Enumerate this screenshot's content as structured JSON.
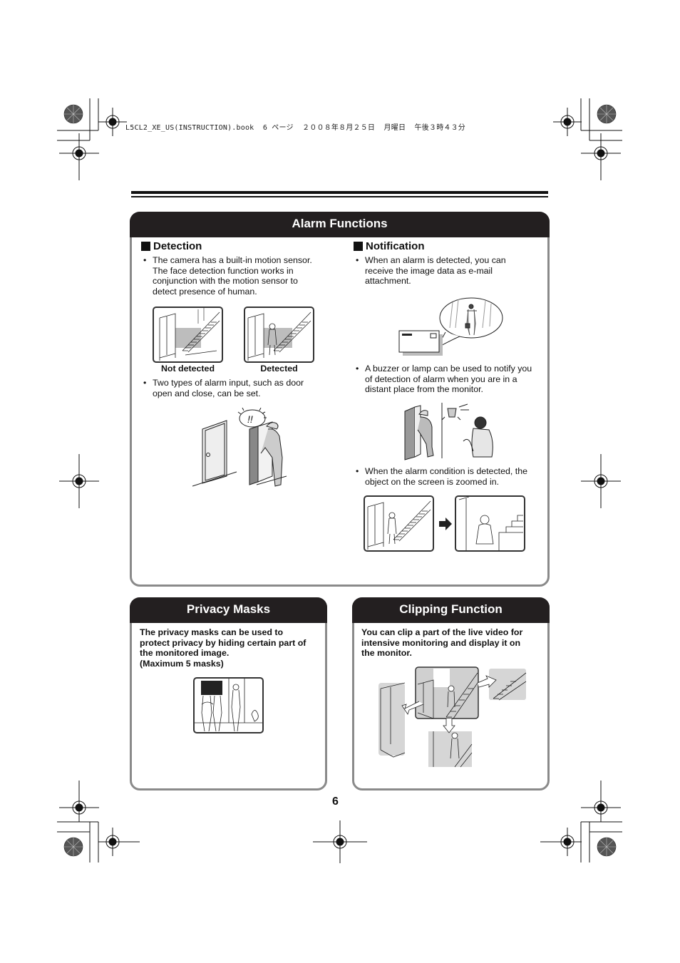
{
  "print_header": "L5CL2_XE_US(INSTRUCTION).book  6 ページ  ２００８年８月２５日  月曜日  午後３時４３分",
  "alarm": {
    "title": "Alarm Functions",
    "detection": {
      "heading": "Detection",
      "bullet1": "The camera has a built-in motion sensor. The face detection function works in conjunction with the motion sensor to detect presence of human.",
      "captions": [
        "Not detected",
        "Detected"
      ],
      "bullet2": "Two types of alarm input, such as door open and close, can be set."
    },
    "notification": {
      "heading": "Notification",
      "bullet1": "When an alarm is detected, you can receive the image data as e-mail attachment.",
      "bullet2": "A buzzer or lamp can be used to notify you of detection of alarm when you are in a distant place from the monitor.",
      "bullet3": "When the alarm condition is detected, the object on the screen is zoomed in."
    },
    "bullet_char": "•",
    "exclaim": "!!"
  },
  "privacy": {
    "title": "Privacy Masks",
    "text_lines": [
      "The privacy masks can be used to",
      "protect privacy by hiding certain part of",
      "the monitored image.",
      "(Maximum 5 masks)"
    ]
  },
  "clipping": {
    "title": "Clipping Function",
    "text_lines": [
      "You can clip a part of the live video for",
      "intensive monitoring and display it on",
      "the monitor."
    ]
  },
  "page_number": "6"
}
